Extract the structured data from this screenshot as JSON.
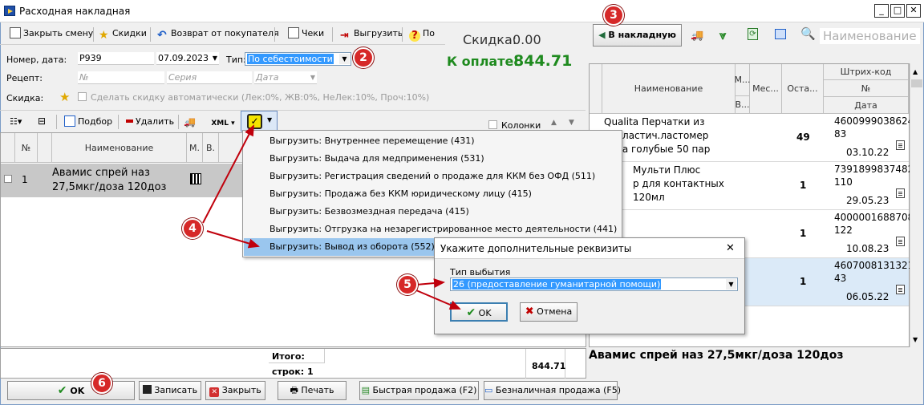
{
  "window": {
    "title": "Расходная накладная"
  },
  "toolbar": {
    "close_shift": "Закрыть смену",
    "discounts": "Скидки",
    "return": "Возврат от покупателя",
    "checks": "Чеки",
    "export": "Выгрузить",
    "help": "По"
  },
  "summary": {
    "discount_label": "Скидка:",
    "discount_value": "0.00",
    "pay_label": "К оплате:",
    "pay_value": "844.71"
  },
  "form": {
    "number_label": "Номер, дата:",
    "number": "Р939",
    "date": "07.09.2023",
    "type_label": "Тип:",
    "type_value": "По себестоимости",
    "recipe_label": "Рецепт:",
    "recipe_no_ph": "№",
    "recipe_series_ph": "Серия",
    "recipe_date_ph": "Дата",
    "discount_label": "Скидка:",
    "auto_discount": "Сделать скидку автоматически (Лек:0%, ЖВ:0%, НеЛек:10%, Проч:10%)"
  },
  "grid_toolbar": {
    "pick": "Подбор",
    "delete": "Удалить",
    "xml": "XML",
    "columns": "Колонки"
  },
  "grid": {
    "headers": {
      "no": "№",
      "name": "Наименование",
      "m": "М.",
      "v": "В."
    },
    "row1": {
      "no": "1",
      "name_line1": "Авамис спрей наз",
      "name_line2": "27,5мкг/доза 120доз"
    }
  },
  "totals": {
    "total_label": "Итого:",
    "rows_label": "строк: 1",
    "amount": "844.71"
  },
  "export_menu": [
    "Выгрузить: Внутреннее перемещение (431)",
    "Выгрузить: Выдача для медприменения (531)",
    "Выгрузить: Регистрация сведений о продаже для ККМ без ОФД (511)",
    "Выгрузить: Продажа без ККМ юридическому лицу  (415)",
    "Выгрузить: Безвозмездная передача (415)",
    "Выгрузить: Отгрузка на незарегистрированное место деятельности (441)",
    "Выгрузить: Вывод из оборота (552)"
  ],
  "dialog": {
    "title": "Укажите дополнительные реквизиты",
    "field_label": "Тип выбытия",
    "value": "26 (предоставление гуманитарной помощи)",
    "ok": "OK",
    "cancel": "Отмена"
  },
  "right": {
    "to_invoice": "В накладную",
    "search_ph": "Наименование",
    "headers": {
      "name": "Наименование",
      "m": "М...",
      "v": "В...",
      "place": "Мес...",
      "rest": "Оста...",
      "barcode": "Штрих-код",
      "no": "№",
      "date": "Дата"
    },
    "rows": [
      {
        "name": "Qualita Перчатки из полиэтил пластич.ластомер пара голубые 50 пар",
        "name_l1": "Qualita Перчатки из",
        "name_l2": "поплaстич.ластомер",
        "name_l3": "пара голубые 50 пар",
        "rest": "49",
        "bc1": "4600999038624",
        "bc2": "83",
        "date": "03.10.22"
      },
      {
        "name": "Мульти Плюс",
        "name_l1": "Мульти Плюс",
        "name_l2": "р для контактных",
        "name_l3": "120мл",
        "rest": "1",
        "bc1": "7391899837482",
        "bc2": "110",
        "date": "29.05.23"
      },
      {
        "name": "",
        "name_l1": "",
        "name_l2": "",
        "name_l3": "",
        "rest": "1",
        "bc1": "4000001688708",
        "bc2": "122",
        "date": "10.08.23"
      },
      {
        "name": "",
        "name_l1": "",
        "name_l2": "",
        "name_l3": "",
        "rest": "1",
        "bc1": "4607008131321",
        "bc2": "43",
        "date": "06.05.22"
      }
    ],
    "selected_name": "Авамис спрей наз 27,5мкг/доза 120доз"
  },
  "bottom": {
    "ok": "OK",
    "save": "Записать",
    "close": "Закрыть",
    "print": "Печать",
    "quick_sale": "Быстрая продажа (F2)",
    "card_sale": "Безналичная продажа (F5)"
  },
  "markers": [
    "2",
    "3",
    "4",
    "5",
    "6"
  ],
  "colors": {
    "accent": "#3399ff",
    "pay": "#1e8a1e",
    "marker": "#d62828",
    "menu_hl": "#9ac6ee"
  }
}
